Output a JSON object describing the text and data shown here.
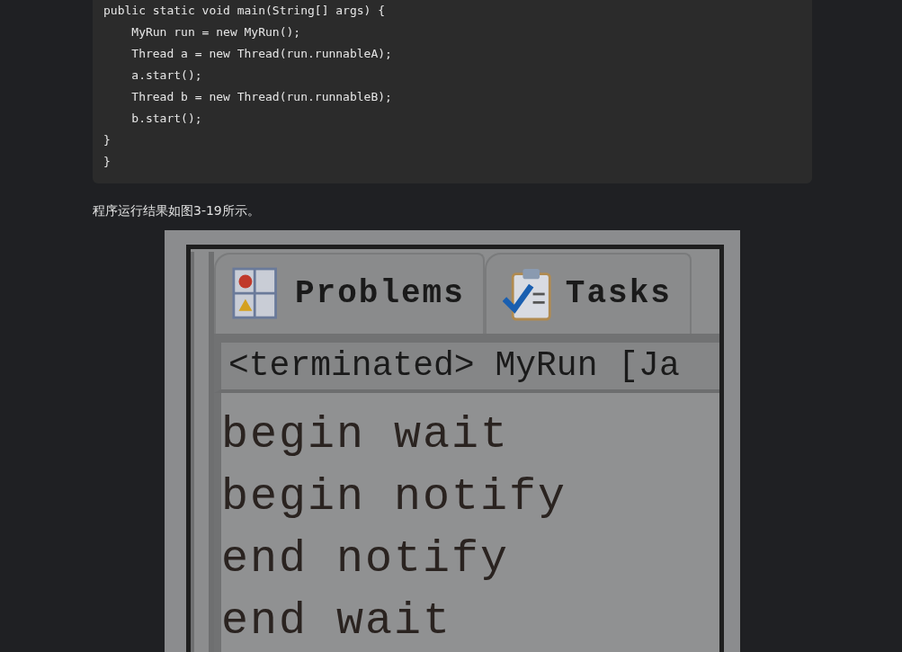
{
  "code_block": {
    "lines": [
      "public static void main(String[] args) {",
      "    MyRun run = new MyRun();",
      "    Thread a = new Thread(run.runnableA);",
      "    a.start();",
      "    Thread b = new Thread(run.runnableB);",
      "    b.start();",
      "}",
      "}"
    ]
  },
  "paragraph": "程序运行结果如图3-19所示。",
  "figure": {
    "tabs": [
      {
        "label": "Problems",
        "kind": "problems"
      },
      {
        "label": "Tasks",
        "kind": "tasks"
      }
    ],
    "console_header": "<terminated> MyRun [Ja",
    "console_lines": [
      "begin wait",
      "begin notify",
      "end notify",
      "end wait"
    ]
  }
}
